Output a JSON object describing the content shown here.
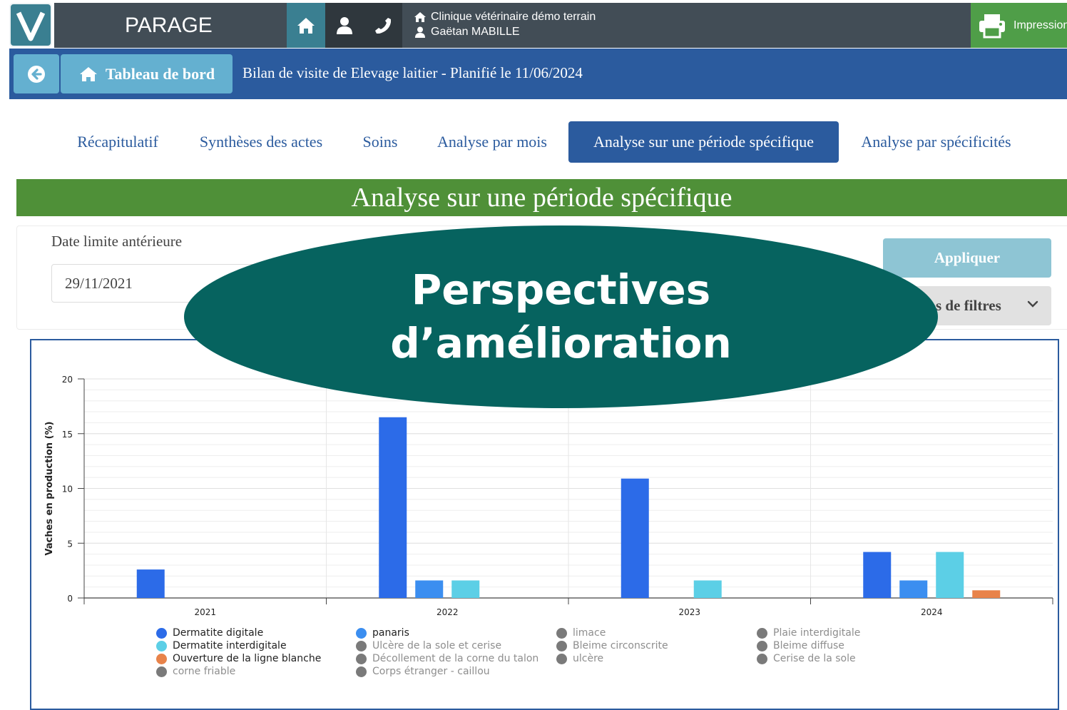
{
  "header": {
    "app_name": "PARAGE",
    "clinic_name": "Clinique vétérinaire démo terrain",
    "user_name": "Gaëtan MABILLE",
    "print_label": "Impression"
  },
  "navbar": {
    "dashboard_label": "Tableau de bord",
    "visit_title": "Bilan de visite de Elevage laitier - Planifié le 11/06/2024"
  },
  "tabs": [
    {
      "label": "Récapitulatif",
      "active": false
    },
    {
      "label": "Synthèses des actes",
      "active": false
    },
    {
      "label": "Soins",
      "active": false
    },
    {
      "label": "Analyse par mois",
      "active": false
    },
    {
      "label": "Analyse sur une période spécifique",
      "active": true
    },
    {
      "label": "Analyse par spécificités",
      "active": false
    }
  ],
  "section_title": "Analyse sur une période spécifique",
  "filters": {
    "date_label": "Date limite antérieure",
    "date_value": "29/11/2021",
    "apply_label": "Appliquer",
    "filter_options_label": "s de filtres"
  },
  "overlay": {
    "line1": "Perspectives",
    "line2": "d’amélioration"
  },
  "colors": {
    "primary_blue": "#2b5b9e",
    "green": "#4f9038",
    "overlay_teal": "#06635f"
  },
  "chart_data": {
    "type": "bar",
    "ylabel": "Vaches en production (%)",
    "ylim": [
      0,
      20
    ],
    "yticks": [
      0,
      5,
      10,
      15,
      20
    ],
    "categories": [
      "2021",
      "2022",
      "2023",
      "2024"
    ],
    "grid": true,
    "series": [
      {
        "name": "Dermatite digitale",
        "color": "#2c6be8",
        "values": [
          2.6,
          16.5,
          10.9,
          4.2
        ]
      },
      {
        "name": "panaris",
        "color": "#3b8ef0",
        "values": [
          0,
          1.6,
          0,
          1.6
        ]
      },
      {
        "name": "Dermatite interdigitale",
        "color": "#5ccfe6",
        "values": [
          0,
          1.6,
          1.6,
          4.2
        ]
      },
      {
        "name": "Ouverture de la ligne blanche",
        "color": "#e8834a",
        "values": [
          0,
          0,
          0,
          0.7
        ]
      }
    ],
    "legend": [
      {
        "name": "Dermatite digitale",
        "color": "#2c6be8",
        "active": true
      },
      {
        "name": "Dermatite interdigitale",
        "color": "#5ccfe6",
        "active": true
      },
      {
        "name": "Ouverture de la ligne blanche",
        "color": "#e8834a",
        "active": true
      },
      {
        "name": "corne friable",
        "color": "#7a7a7a",
        "active": false
      },
      {
        "name": "panaris",
        "color": "#3b8ef0",
        "active": true
      },
      {
        "name": "Ulcère de la sole et cerise",
        "color": "#7a7a7a",
        "active": false
      },
      {
        "name": "Décollement de la corne du talon",
        "color": "#7a7a7a",
        "active": false
      },
      {
        "name": "Corps étranger - caillou",
        "color": "#7a7a7a",
        "active": false
      },
      {
        "name": "limace",
        "color": "#7a7a7a",
        "active": false
      },
      {
        "name": "Bleime circonscrite",
        "color": "#7a7a7a",
        "active": false
      },
      {
        "name": "ulcère",
        "color": "#7a7a7a",
        "active": false
      },
      {
        "name": "Plaie interdigitale",
        "color": "#7a7a7a",
        "active": false
      },
      {
        "name": "Bleime diffuse",
        "color": "#7a7a7a",
        "active": false
      },
      {
        "name": "Cerise de la sole",
        "color": "#7a7a7a",
        "active": false
      }
    ]
  }
}
